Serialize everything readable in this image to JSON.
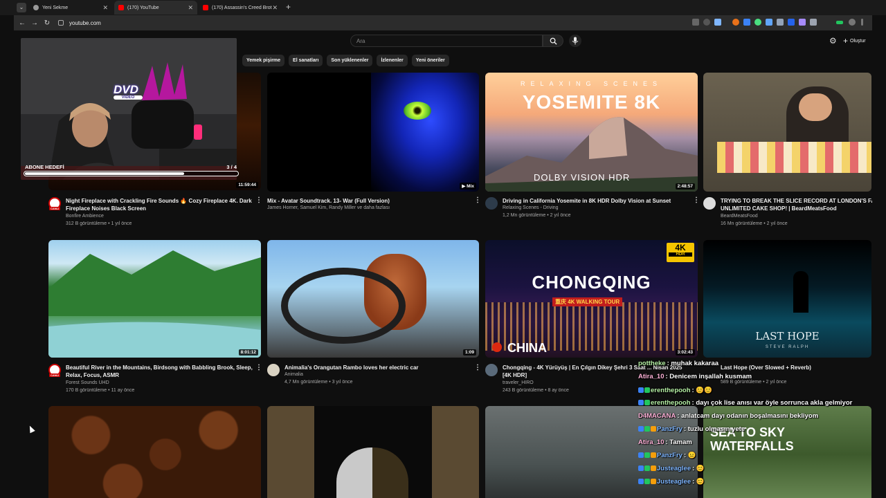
{
  "browser": {
    "tabs": [
      {
        "title": "Yeni Sekme",
        "active": false
      },
      {
        "title": "(170) YouTube",
        "active": true
      },
      {
        "title": "(170) Assassin's Creed Brot",
        "active": false
      }
    ],
    "url": "youtube.com"
  },
  "youtube": {
    "search_placeholder": "Ara",
    "create_label": "Oluştur",
    "chips": [
      "Yemek pişirme",
      "El sanatları",
      "Son yüklenenler",
      "İzlenenler",
      "Yeni öneriler"
    ],
    "videos": [
      {
        "title": "Night Fireplace with Crackling Fire Sounds 🔥 Cozy Fireplace 4K. Dark Fireplace Noises Black Screen",
        "channel": "Bonfire Ambience",
        "stats": "312 B görüntüleme • 1 yıl önce",
        "duration": "11:59:44",
        "avatar_label": "CANLI"
      },
      {
        "title": "Mix - Avatar Soundtrack. 13- War (Full Version)",
        "channel": "James Horner, Samuel Kim, Randy Miller ve daha fazlası",
        "stats": "",
        "duration": "Mix",
        "avatar_label": ""
      },
      {
        "title": "Driving in California Yosemite in 8K HDR Dolby Vision at Sunset",
        "channel": "Relaxing Scenes - Driving",
        "stats": "1,2 Mn görüntüleme • 2 yıl önce",
        "duration": "2:48:57",
        "avatar_label": ""
      },
      {
        "title": "TRYING TO BREAK THE SLICE RECORD AT LONDON'S FAMO UNLIMITED CAKE SHOP! | BeardMeatsFood",
        "channel": "BeardMeatsFood",
        "stats": "16 Mn görüntüleme • 2 yıl önce",
        "duration": "",
        "avatar_label": ""
      },
      {
        "title": "Beautiful River in the Mountains, Birdsong with Babbling Brook, Sleep, Relax, Focus, ASMR",
        "channel": "Forest Sounds UHD",
        "stats": "170 B görüntüleme • 11 ay önce",
        "duration": "8:01:12",
        "avatar_label": "CANLI"
      },
      {
        "title": "Animalia's Orangutan Rambo loves her electric car",
        "channel": "Animalia",
        "stats": "4,7 Mn görüntüleme • 3 yıl önce",
        "duration": "1:09",
        "avatar_label": ""
      },
      {
        "title": "Chongqing - 4K Yürüyüş | En Çılgın Dikey Şehri 3 Saat ... Nisan 2025 [4K HDR]",
        "channel": "traveler_HIRO",
        "stats": "243 B görüntüleme • 8 ay önce",
        "duration": "3:02:43",
        "avatar_label": ""
      },
      {
        "title": "Last Hope (Over Slowed + Reverb)",
        "channel": "",
        "stats": "589 B görüntüleme • 2 yıl önce",
        "duration": "",
        "avatar_label": ""
      }
    ],
    "thumb_texts": {
      "yosemite_top": "RELAXING SCENES",
      "yosemite_title": "YOSEMITE 8K",
      "yosemite_badge": "DOLBY VISION HDR",
      "chongqing_title": "CHONGQING",
      "chongqing_sub": "重庆 4K WALKING TOUR",
      "chongqing_bottom": "CHINA",
      "chongqing_badge": "4K",
      "chongqing_badge2": "HDR",
      "lasthope_title": "LAST HOPE",
      "lasthope_artist": "STEVE RALPH",
      "waterfall_title1": "SEA TO SKY",
      "waterfall_title2": "WATERFALLS"
    }
  },
  "stream": {
    "dvd_text": "DVD",
    "dvd_sub": "VIDEO",
    "goal_label": "ABONE HEDEFİ",
    "goal_count": "3 / 4",
    "goal_progress": 0.75,
    "chat": [
      {
        "user": "pottheke",
        "msg": ": muhak kakaraa"
      },
      {
        "user": "Atira_10",
        "msg": ": Denicem inşallah kusmam"
      },
      {
        "user": "erenthepooh",
        "msg": ": 😊😊"
      },
      {
        "user": "erenthepooh",
        "msg": ": dayı çok lise anısı var öyle sorrunca akla gelmiyor"
      },
      {
        "user": "D4MACANA",
        "msg": ": anlatcam dayı odanın boşalmasını bekliyom"
      },
      {
        "user": "PanzFry",
        "msg": ": tuzlu olmasın yete"
      },
      {
        "user": "Atira_10",
        "msg": ": Tamam"
      },
      {
        "user": "PanzFry",
        "msg": ": 😐"
      },
      {
        "user": "Justeaglee",
        "msg": ": 😊"
      },
      {
        "user": "Justeaglee",
        "msg": ": 😊"
      }
    ]
  },
  "colors": {
    "yt_bg": "#0f0f0f",
    "chip_bg": "#272727",
    "live_red": "#cc0000",
    "chat_name_green": "#b5f0a4",
    "chat_name_blue": "#7fb6ff",
    "chat_name_pink": "#ffb3d9"
  }
}
